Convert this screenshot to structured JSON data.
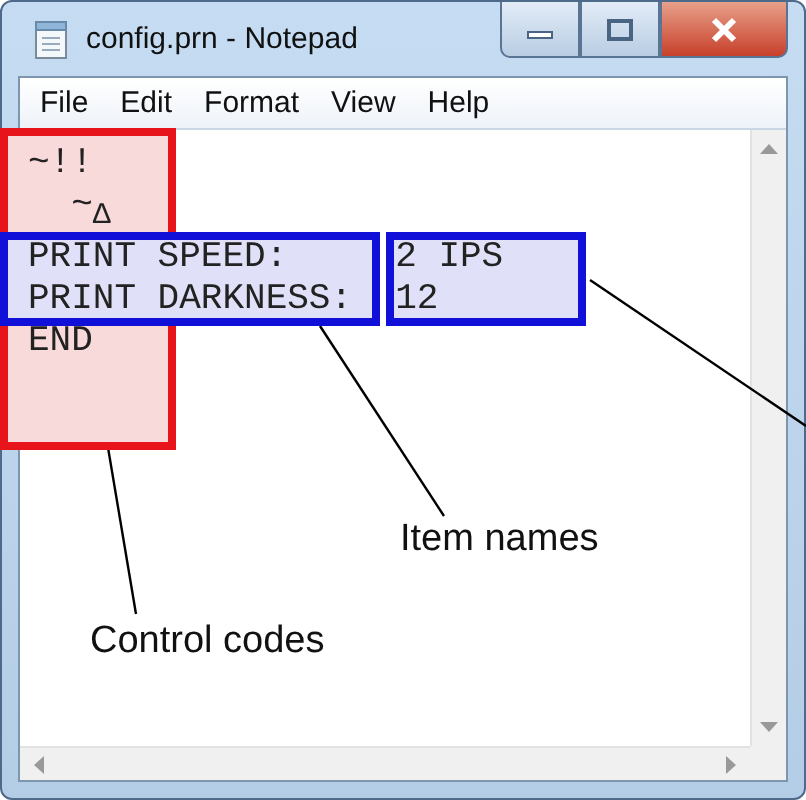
{
  "window": {
    "title": "config.prn - Notepad"
  },
  "menu": [
    "File",
    "Edit",
    "Format",
    "View",
    "Help"
  ],
  "editor": {
    "control_lines": [
      "~!!",
      "  ~$_{Δ}$"
    ],
    "settings": [
      {
        "name": "PRINT SPEED:",
        "value": "2 IPS"
      },
      {
        "name": "PRINT DARKNESS:",
        "value": "12"
      }
    ],
    "end_line": "END"
  },
  "annotations": [
    {
      "label": "Item names"
    },
    {
      "label": "Control codes"
    }
  ]
}
